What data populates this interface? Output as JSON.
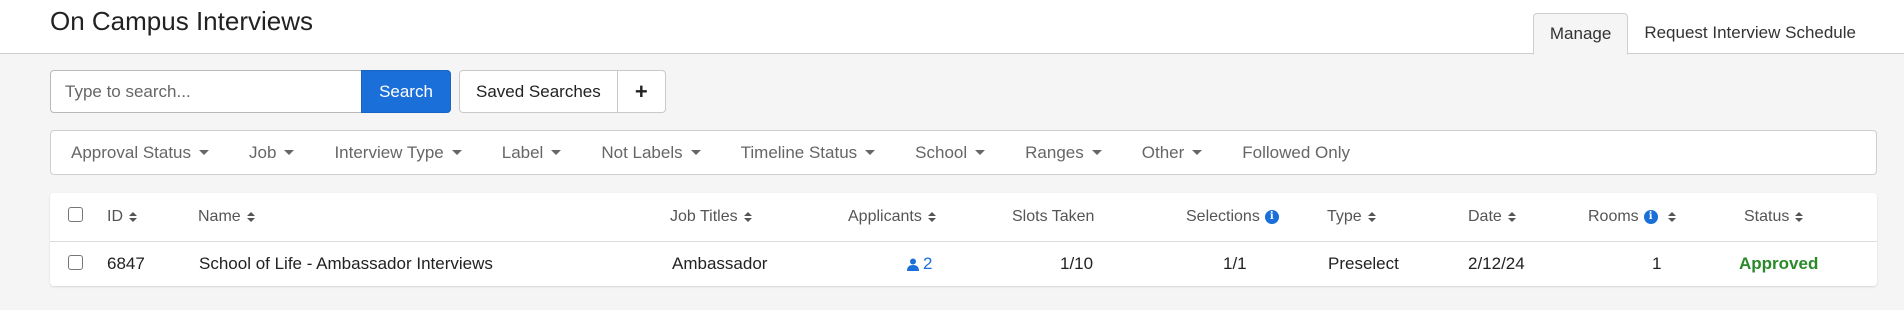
{
  "header": {
    "title": "On Campus Interviews",
    "tabs": [
      {
        "label": "Manage",
        "active": true
      },
      {
        "label": "Request Interview Schedule",
        "active": false
      }
    ]
  },
  "search": {
    "placeholder": "Type to search...",
    "value": "",
    "search_label": "Search",
    "saved_searches_label": "Saved Searches",
    "add_label": "+"
  },
  "filters": [
    {
      "label": "Approval Status",
      "dropdown": true
    },
    {
      "label": "Job",
      "dropdown": true
    },
    {
      "label": "Interview Type",
      "dropdown": true
    },
    {
      "label": "Label",
      "dropdown": true
    },
    {
      "label": "Not Labels",
      "dropdown": true
    },
    {
      "label": "Timeline Status",
      "dropdown": true
    },
    {
      "label": "School",
      "dropdown": true
    },
    {
      "label": "Ranges",
      "dropdown": true
    },
    {
      "label": "Other",
      "dropdown": true
    },
    {
      "label": "Followed Only",
      "dropdown": false
    }
  ],
  "table": {
    "columns": {
      "id": "ID",
      "name": "Name",
      "job_titles": "Job Titles",
      "applicants": "Applicants",
      "slots_taken": "Slots Taken",
      "selections": "Selections",
      "type": "Type",
      "date": "Date",
      "rooms": "Rooms",
      "status": "Status"
    },
    "rows": [
      {
        "id": "6847",
        "name": "School of Life - Ambassador Interviews",
        "job_titles": "Ambassador",
        "applicants": "2",
        "slots_taken": "1/10",
        "selections": "1/1",
        "type": "Preselect",
        "date": "2/12/24",
        "rooms": "1",
        "status": "Approved"
      }
    ]
  },
  "colors": {
    "accent": "#1a6fd8",
    "approved": "#2a8a2a"
  }
}
